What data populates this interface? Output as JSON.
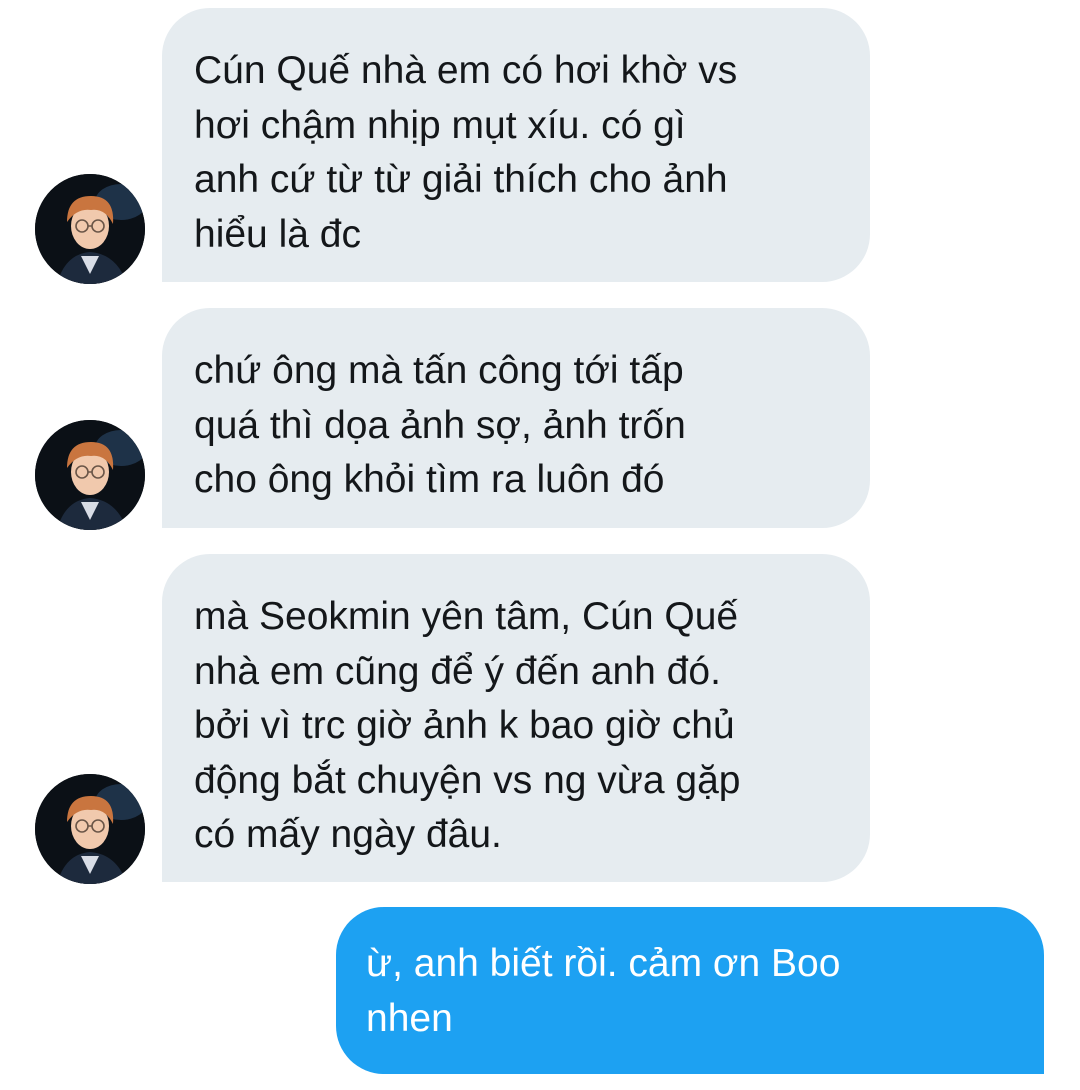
{
  "conversation": {
    "messages": [
      {
        "sender": "received",
        "text": "Cún Quế nhà em có hơi khờ vs\nhơi chậm nhịp mụt xíu. có gì\nanh cứ từ từ giải thích cho ảnh\nhiểu là đc"
      },
      {
        "sender": "received",
        "text": "chứ ông mà tấn công tới tấp\nquá thì dọa ảnh sợ, ảnh trốn\ncho ông khỏi tìm ra luôn đó"
      },
      {
        "sender": "received",
        "text": "mà Seokmin yên tâm, Cún Quế\nnhà em cũng để ý đến anh đó.\nbởi vì trc giờ ảnh k bao giờ chủ\nđộng bắt chuyện vs ng vừa gặp\ncó mấy ngày đâu."
      },
      {
        "sender": "sent",
        "text": "ừ, anh biết rồi. cảm ơn Boo\nnhen"
      }
    ]
  },
  "colors": {
    "received_bubble": "#e6ecf0",
    "received_text": "#14171a",
    "sent_bubble": "#1da1f2",
    "sent_text": "#ffffff",
    "background": "#ffffff"
  },
  "icons": {
    "avatar": "contact-avatar-photo"
  }
}
